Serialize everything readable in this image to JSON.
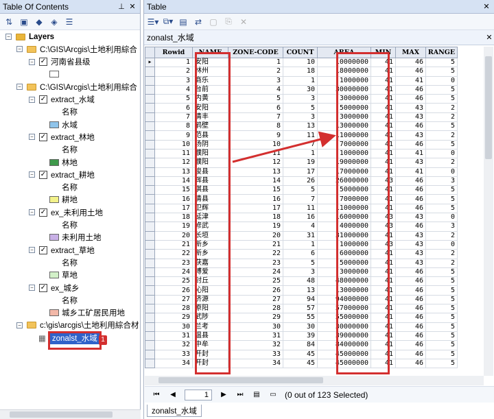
{
  "toc": {
    "title": "Table Of Contents",
    "tree": [
      {
        "kind": "layers",
        "label": "Layers"
      },
      {
        "kind": "group",
        "label": "C:\\GIS\\Arcgis\\土地利用綜合"
      },
      {
        "kind": "layer",
        "label": "河南省县级",
        "checked": true
      },
      {
        "kind": "swatch",
        "label": "",
        "color": "#ffffff"
      },
      {
        "kind": "group",
        "label": "C:\\GIS\\Arcgis\\土地利用綜合"
      },
      {
        "kind": "layer",
        "label": "extract_水域",
        "checked": true
      },
      {
        "kind": "field",
        "label": "名称"
      },
      {
        "kind": "swatch",
        "label": "水域",
        "color": "#8fc4ea"
      },
      {
        "kind": "layer",
        "label": "extract_林地",
        "checked": true
      },
      {
        "kind": "field",
        "label": "名称"
      },
      {
        "kind": "swatch",
        "label": "林地",
        "color": "#3f9a4c"
      },
      {
        "kind": "layer",
        "label": "extract_耕地",
        "checked": true
      },
      {
        "kind": "field",
        "label": "名称"
      },
      {
        "kind": "swatch",
        "label": "耕地",
        "color": "#f3f28a"
      },
      {
        "kind": "layer",
        "label": "ex_未利用土地",
        "checked": true
      },
      {
        "kind": "field",
        "label": "名称"
      },
      {
        "kind": "swatch",
        "label": "未利用土地",
        "color": "#c8b0e6"
      },
      {
        "kind": "layer",
        "label": "extract_草地",
        "checked": true
      },
      {
        "kind": "field",
        "label": "名称"
      },
      {
        "kind": "swatch",
        "label": "草地",
        "color": "#d2f0c8"
      },
      {
        "kind": "layer",
        "label": "ex_城乡",
        "checked": true
      },
      {
        "kind": "field",
        "label": "名称"
      },
      {
        "kind": "swatch",
        "label": "城乡工矿居民用地",
        "color": "#f2b8a8"
      },
      {
        "kind": "group",
        "label": "c:\\gis\\arcgis\\土地利用綜合材"
      },
      {
        "kind": "table",
        "label": "zonalst_水域"
      }
    ],
    "badge": "1"
  },
  "table": {
    "title": "Table",
    "doc_title": "zonalst_水域",
    "columns": [
      "Rowid",
      "NAME",
      "ZONE-CODE",
      "COUNT",
      "AREA",
      "MIN",
      "MAX",
      "RANGE"
    ],
    "rows": [
      [
        "1",
        "安阳",
        "1",
        "10",
        "10000000",
        "41",
        "46",
        "5"
      ],
      [
        "2",
        "林州",
        "2",
        "18",
        "18000000",
        "41",
        "46",
        "5"
      ],
      [
        "3",
        "商乐",
        "3",
        "1",
        "1000000",
        "41",
        "41",
        "0"
      ],
      [
        "4",
        "台前",
        "4",
        "30",
        "30000000",
        "41",
        "46",
        "5"
      ],
      [
        "5",
        "内黄",
        "5",
        "3",
        "3000000",
        "41",
        "46",
        "5"
      ],
      [
        "6",
        "安阳",
        "6",
        "5",
        "5000000",
        "41",
        "43",
        "2"
      ],
      [
        "7",
        "清丰",
        "7",
        "3",
        "3000000",
        "41",
        "43",
        "2"
      ],
      [
        "8",
        "鹤壁",
        "8",
        "13",
        "13000000",
        "41",
        "46",
        "5"
      ],
      [
        "9",
        "范县",
        "9",
        "11",
        "11000000",
        "41",
        "43",
        "2"
      ],
      [
        "10",
        "汤阴",
        "10",
        "7",
        "7000000",
        "41",
        "46",
        "5"
      ],
      [
        "11",
        "濮阳",
        "11",
        "1",
        "1000000",
        "41",
        "41",
        "0"
      ],
      [
        "12",
        "濮阳",
        "12",
        "19",
        "19000000",
        "41",
        "43",
        "2"
      ],
      [
        "13",
        "浚县",
        "13",
        "17",
        "17000000",
        "41",
        "41",
        "0"
      ],
      [
        "14",
        "辉县",
        "14",
        "26",
        "26000000",
        "43",
        "46",
        "3"
      ],
      [
        "15",
        "淇县",
        "15",
        "5",
        "5000000",
        "41",
        "46",
        "5"
      ],
      [
        "16",
        "清县",
        "16",
        "7",
        "7000000",
        "41",
        "46",
        "5"
      ],
      [
        "17",
        "卫辉",
        "17",
        "11",
        "11000000",
        "41",
        "46",
        "5"
      ],
      [
        "18",
        "延津",
        "18",
        "16",
        "16000000",
        "43",
        "43",
        "0"
      ],
      [
        "19",
        "修武",
        "19",
        "4",
        "4000000",
        "43",
        "46",
        "3"
      ],
      [
        "20",
        "长垣",
        "20",
        "31",
        "31000000",
        "41",
        "43",
        "2"
      ],
      [
        "21",
        "新乡",
        "21",
        "1",
        "1000000",
        "43",
        "43",
        "0"
      ],
      [
        "22",
        "新乡",
        "22",
        "6",
        "6000000",
        "41",
        "43",
        "2"
      ],
      [
        "23",
        "获嘉",
        "23",
        "5",
        "5000000",
        "41",
        "43",
        "2"
      ],
      [
        "24",
        "博爱",
        "24",
        "3",
        "3000000",
        "41",
        "46",
        "5"
      ],
      [
        "25",
        "封丘",
        "25",
        "48",
        "48000000",
        "41",
        "46",
        "5"
      ],
      [
        "26",
        "沁阳",
        "26",
        "13",
        "13000000",
        "41",
        "46",
        "5"
      ],
      [
        "27",
        "济源",
        "27",
        "94",
        "94000000",
        "41",
        "46",
        "5"
      ],
      [
        "28",
        "原阳",
        "28",
        "57",
        "57000000",
        "41",
        "46",
        "5"
      ],
      [
        "29",
        "武陟",
        "29",
        "55",
        "55000000",
        "41",
        "46",
        "5"
      ],
      [
        "30",
        "兰考",
        "30",
        "30",
        "30000000",
        "41",
        "46",
        "5"
      ],
      [
        "31",
        "温县",
        "31",
        "39",
        "39000000",
        "41",
        "46",
        "5"
      ],
      [
        "32",
        "中牟",
        "32",
        "84",
        "84000000",
        "41",
        "46",
        "5"
      ],
      [
        "33",
        "开封",
        "33",
        "45",
        "45000000",
        "41",
        "46",
        "5"
      ],
      [
        "34",
        "开封",
        "34",
        "45",
        "45000000",
        "41",
        "46",
        "5"
      ]
    ],
    "nav": {
      "page": "1",
      "selection_text": "(0 out of 123 Selected)"
    },
    "bottom_tab": "zonalst_水域"
  }
}
